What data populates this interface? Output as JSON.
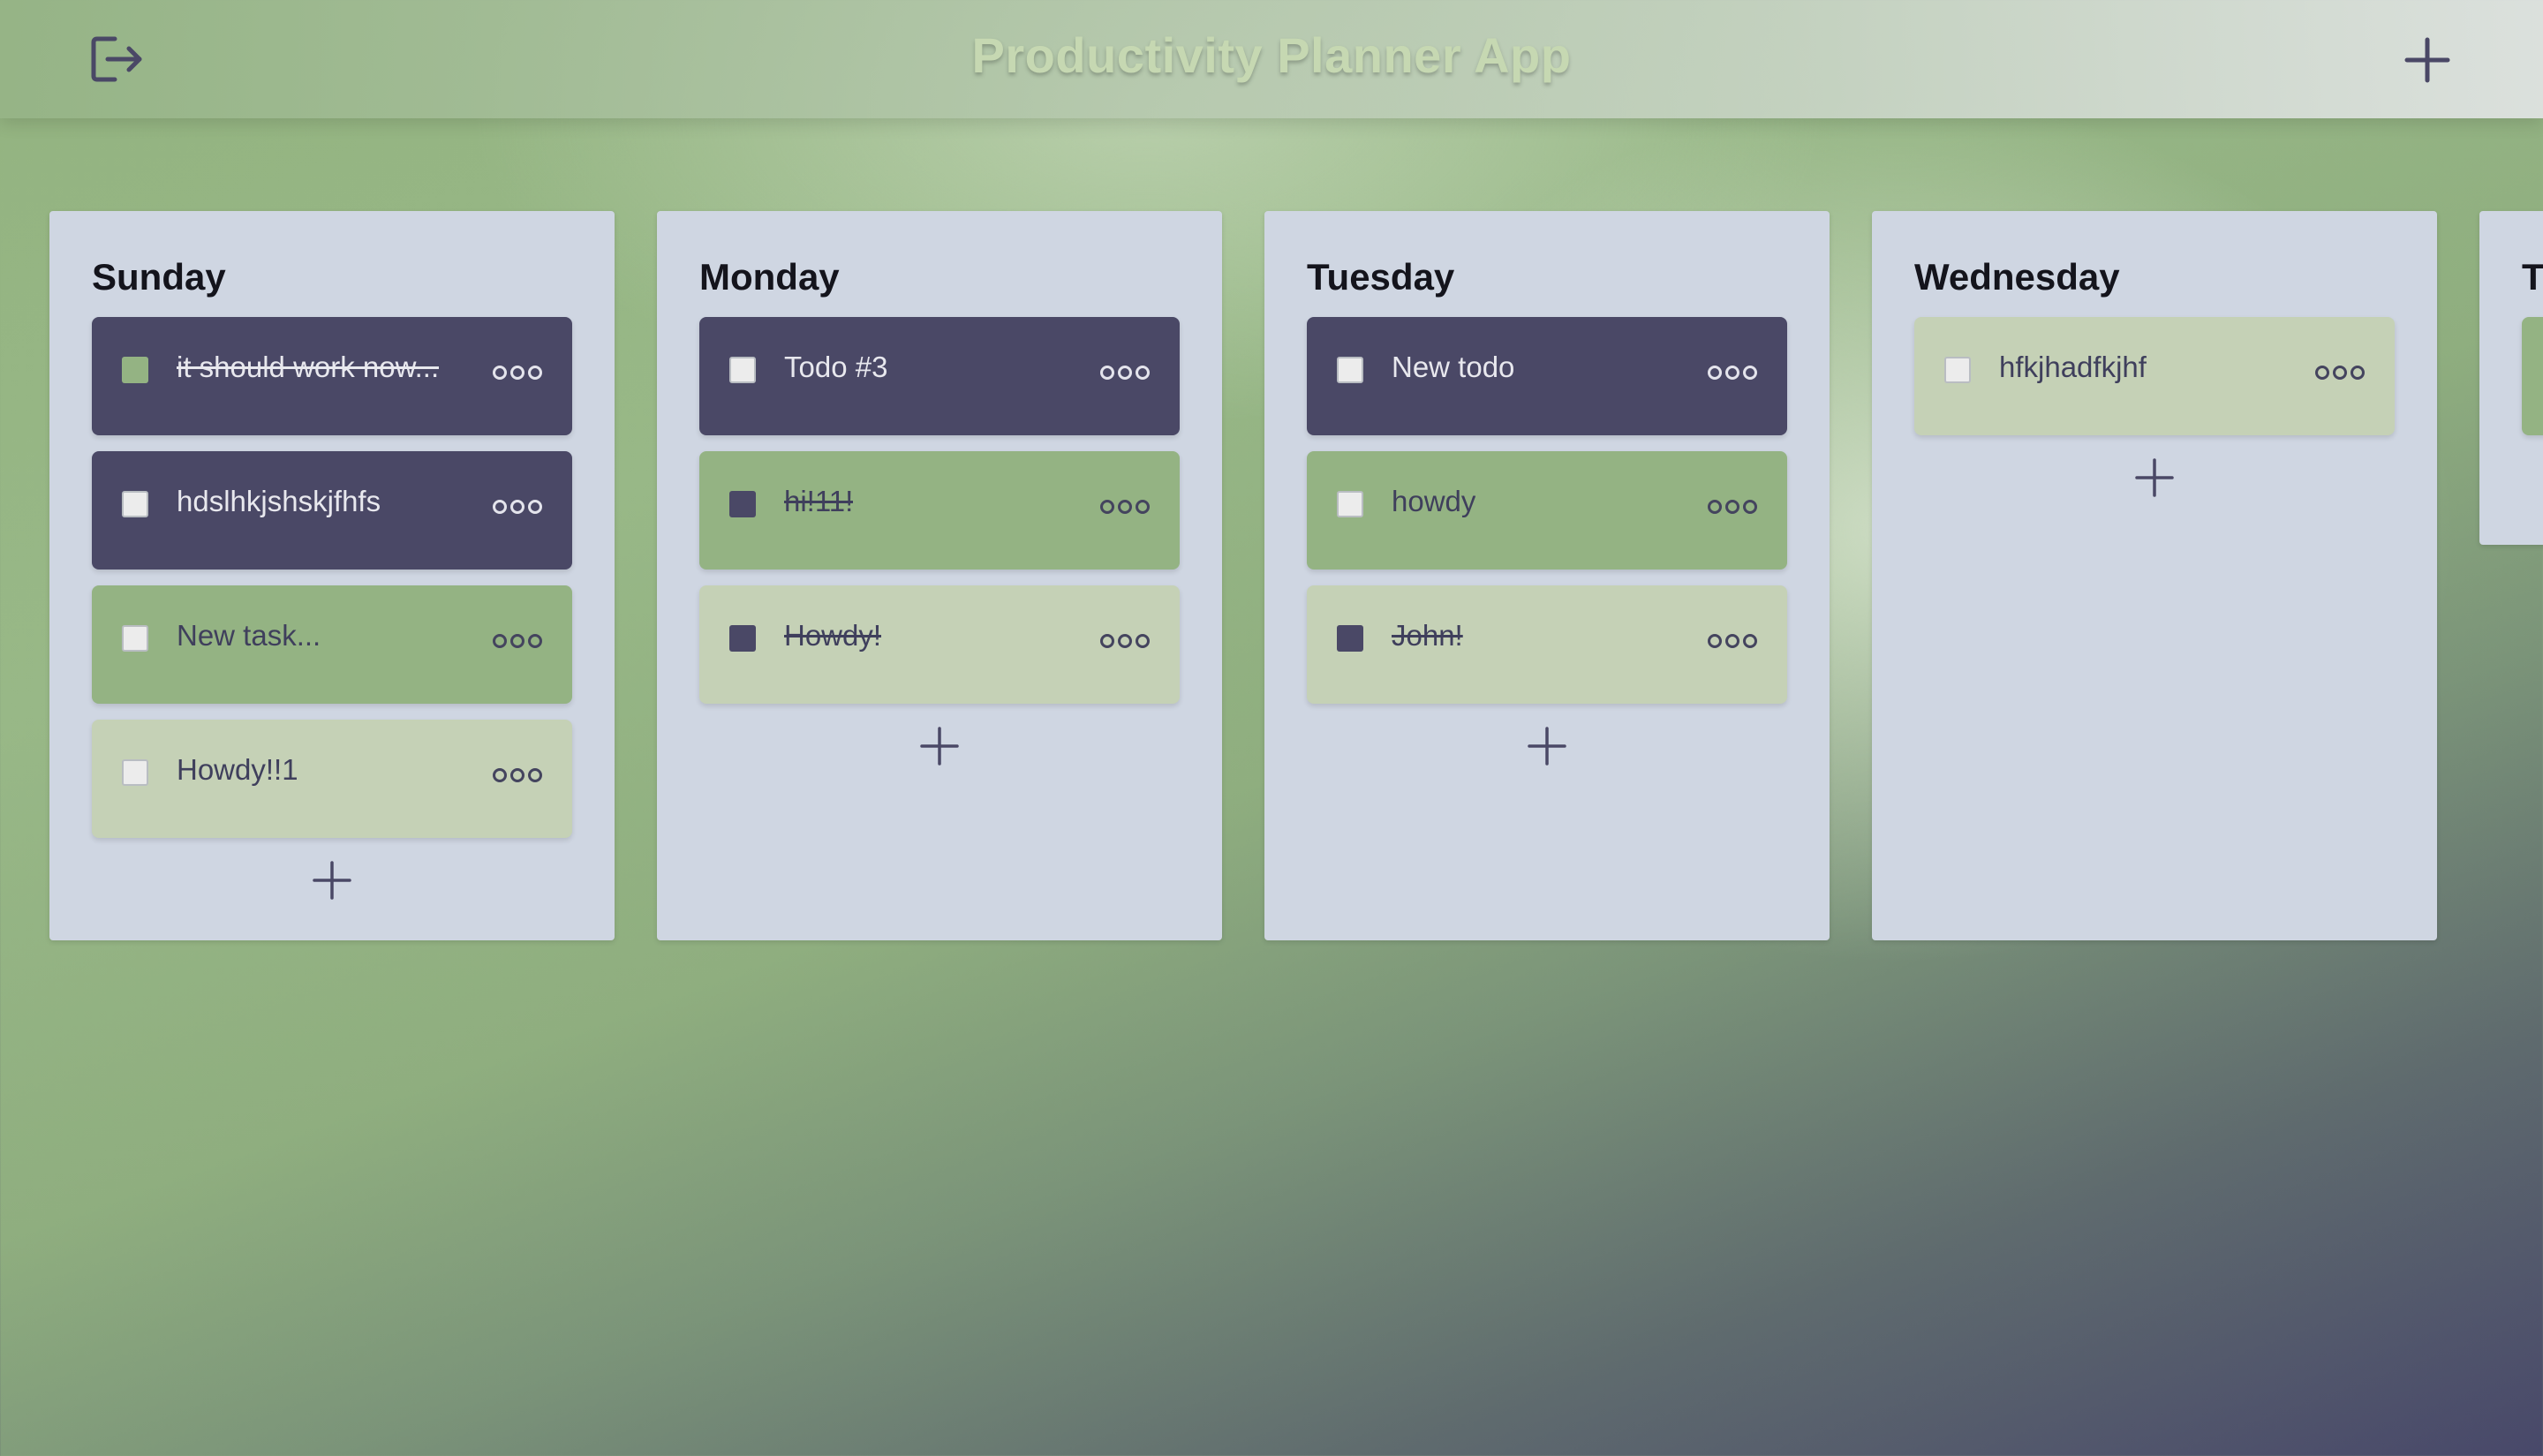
{
  "app": {
    "title": "Productivity Planner App"
  },
  "colors": {
    "dark_task": "#4a4866",
    "green_task": "#94b383",
    "light_task": "#c5d1b6",
    "column_bg": "#cfd6e2",
    "title_text": "#c6d8b2"
  },
  "icons": {
    "logout": "logout-icon",
    "add": "plus-icon",
    "more": "more-horizontal-icon"
  },
  "days": [
    {
      "name": "Sunday",
      "todos": [
        {
          "text": "it should work now...",
          "done": true,
          "color": "dark"
        },
        {
          "text": "hdslhkjshskjfhfs",
          "done": false,
          "color": "dark"
        },
        {
          "text": "New task...",
          "done": false,
          "color": "green"
        },
        {
          "text": "Howdy!!1",
          "done": false,
          "color": "light"
        }
      ]
    },
    {
      "name": "Monday",
      "todos": [
        {
          "text": "Todo #3",
          "done": false,
          "color": "dark"
        },
        {
          "text": "hi!11!",
          "done": true,
          "color": "green"
        },
        {
          "text": "Howdy!",
          "done": true,
          "color": "light"
        }
      ]
    },
    {
      "name": "Tuesday",
      "todos": [
        {
          "text": "New todo",
          "done": false,
          "color": "dark"
        },
        {
          "text": "howdy",
          "done": false,
          "color": "green"
        },
        {
          "text": "John!",
          "done": true,
          "color": "light"
        }
      ]
    },
    {
      "name": "Wednesday",
      "todos": [
        {
          "text": "hfkjhadfkjhf",
          "done": false,
          "color": "light"
        }
      ]
    },
    {
      "name": "T",
      "todos": [
        {
          "text": "",
          "done": false,
          "color": "green"
        }
      ]
    }
  ]
}
